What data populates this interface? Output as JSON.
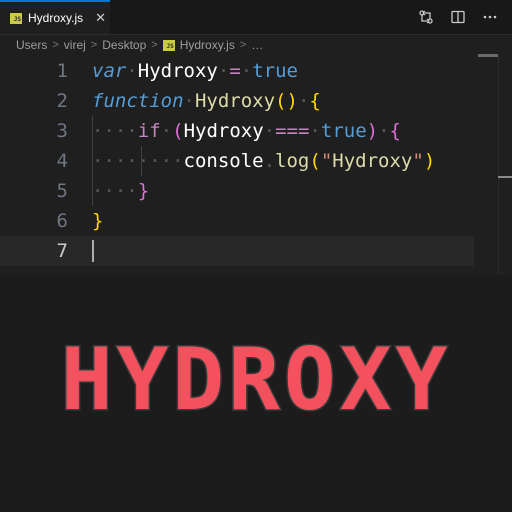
{
  "tab": {
    "filename": "Hydroxy.js",
    "icon": "js-file-icon",
    "badge": "JS",
    "close": "✕"
  },
  "breadcrumb": {
    "items": [
      "Users",
      "virej",
      "Desktop",
      "Hydroxy.js",
      "…"
    ]
  },
  "code": {
    "line_numbers": [
      "1",
      "2",
      "3",
      "4",
      "5",
      "6",
      "7"
    ],
    "line1": {
      "kw": "var",
      "name": "Hydroxy",
      "op": "=",
      "val": "true"
    },
    "line2": {
      "kw": "function",
      "name": "Hydroxy",
      "parens": "()",
      "brace": "{"
    },
    "line3": {
      "kw": "if",
      "open": "(",
      "name": "Hydroxy",
      "op": "===",
      "val": "true",
      "close": ")",
      "brace": "{"
    },
    "line4": {
      "obj": "console",
      "dot": ".",
      "method": "log",
      "open": "(",
      "q1": "\"",
      "str": "Hydroxy",
      "q2": "\"",
      "close": ")"
    },
    "line5": {
      "brace": "}"
    },
    "line6": {
      "brace": "}"
    }
  },
  "banner": {
    "text": "HYDROXY"
  },
  "colors": {
    "accent": "#0078d4",
    "banner": "#f4515f",
    "js_badge": "#cbcb41"
  }
}
